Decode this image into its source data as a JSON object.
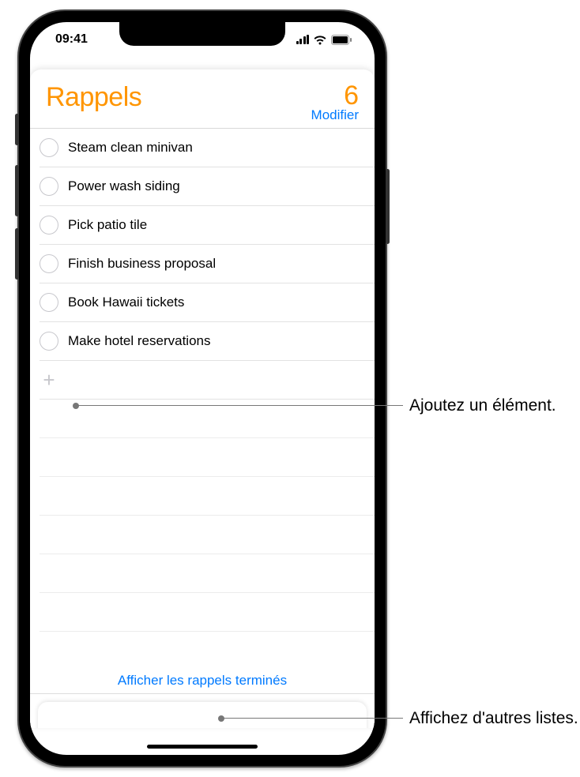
{
  "status": {
    "time": "09:41"
  },
  "header": {
    "title": "Rappels",
    "count": "6",
    "edit": "Modifier"
  },
  "reminders": [
    {
      "text": "Steam clean minivan"
    },
    {
      "text": "Power wash siding"
    },
    {
      "text": "Pick patio tile"
    },
    {
      "text": "Finish business proposal"
    },
    {
      "text": "Book Hawaii tickets"
    },
    {
      "text": "Make hotel reservations"
    }
  ],
  "footer": {
    "show_completed": "Afficher les rappels terminés"
  },
  "callouts": {
    "add": "Ajoutez un élément.",
    "other_lists": "Affichez d'autres listes."
  }
}
